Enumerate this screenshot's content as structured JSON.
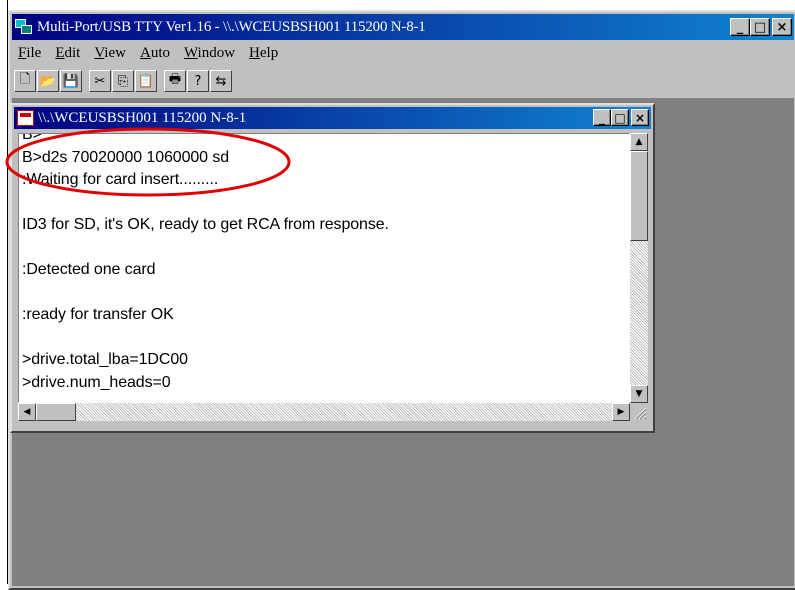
{
  "app": {
    "title": "Multi-Port/USB TTY Ver1.16 - \\\\.\\WCEUSBSH001 115200  N-8-1",
    "menu": [
      {
        "pre": "",
        "ul": "F",
        "post": "ile"
      },
      {
        "pre": "",
        "ul": "E",
        "post": "dit"
      },
      {
        "pre": "",
        "ul": "V",
        "post": "iew"
      },
      {
        "pre": "",
        "ul": "A",
        "post": "uto"
      },
      {
        "pre": "",
        "ul": "W",
        "post": "indow"
      },
      {
        "pre": "",
        "ul": "H",
        "post": "elp"
      }
    ],
    "window_buttons": {
      "minimize": "_",
      "maximize": "□",
      "close": "×"
    }
  },
  "toolbar": {
    "buttons": [
      {
        "name": "new-icon",
        "glyph": "🗋"
      },
      {
        "name": "open-icon",
        "glyph": "📂"
      },
      {
        "name": "save-icon",
        "glyph": "💾"
      },
      {
        "name": "cut-icon",
        "glyph": "✂"
      },
      {
        "name": "copy-icon",
        "glyph": "⎘"
      },
      {
        "name": "paste-icon",
        "glyph": "📋"
      },
      {
        "name": "print-icon",
        "glyph": "🖶"
      },
      {
        "name": "help-icon",
        "glyph": "?"
      },
      {
        "name": "context-help-icon",
        "glyph": "⇆"
      }
    ]
  },
  "child": {
    "title": "\\\\.\\WCEUSBSH001 115200  N-8-1",
    "window_buttons": {
      "minimize": "_",
      "maximize": "□",
      "close": "×"
    }
  },
  "terminal": {
    "lines": [
      "B>",
      "B>d2s 70020000 1060000 sd",
      ":Waiting for card insert.........",
      "",
      "ID3 for SD, it's OK, ready to get RCA from response.",
      "",
      ":Detected one card",
      "",
      ":ready for transfer OK",
      "",
      ">drive.total_lba=1DC00",
      ">drive.num_heads=0"
    ]
  },
  "colors": {
    "titlebar_start": "#000080",
    "titlebar_end": "#1084d0",
    "annotation": "#e00000",
    "face": "#c0c0c0",
    "workspace": "#808080"
  }
}
